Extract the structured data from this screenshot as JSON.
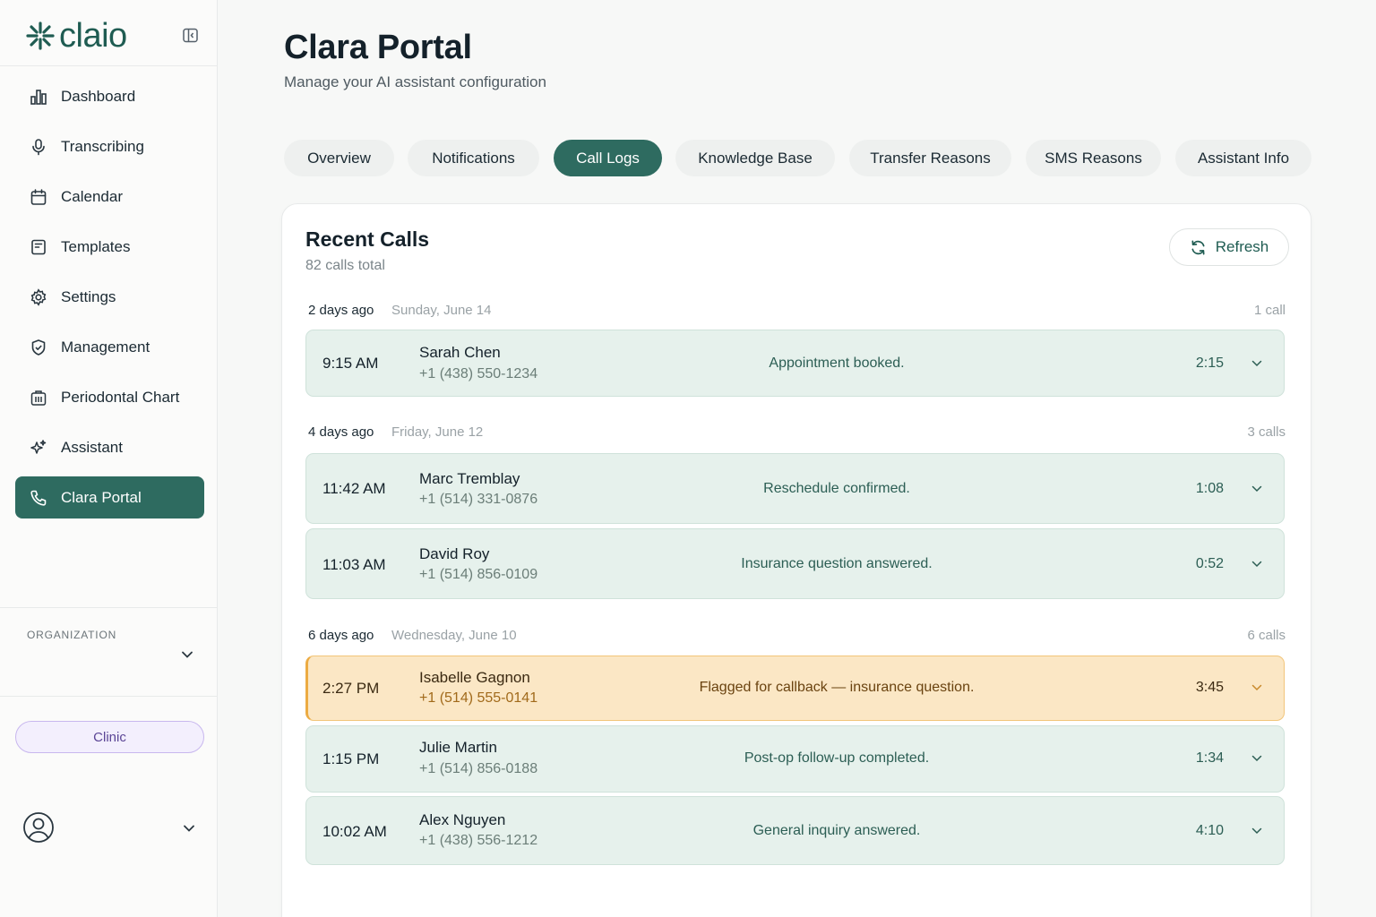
{
  "brand": {
    "name": "claio"
  },
  "sidebar": {
    "items": [
      {
        "label": "Dashboard",
        "icon": "bar-chart-icon",
        "active": false
      },
      {
        "label": "Transcribing",
        "icon": "microphone-icon",
        "active": false
      },
      {
        "label": "Calendar",
        "icon": "calendar-icon",
        "active": false
      },
      {
        "label": "Templates",
        "icon": "template-icon",
        "active": false
      },
      {
        "label": "Settings",
        "icon": "gear-icon",
        "active": false
      },
      {
        "label": "Management",
        "icon": "shield-icon",
        "active": false
      },
      {
        "label": "Periodontal Chart",
        "icon": "tooth-chart-icon",
        "active": false
      },
      {
        "label": "Assistant",
        "icon": "sparkle-icon",
        "active": false
      },
      {
        "label": "Clara Portal",
        "icon": "phone-icon",
        "active": true
      }
    ],
    "organization_label": "ORGANIZATION",
    "clinic_badge": "Clinic"
  },
  "header": {
    "title": "Clara Portal",
    "subtitle": "Manage your AI assistant configuration"
  },
  "tabs": [
    {
      "label": "Overview",
      "active": false
    },
    {
      "label": "Notifications",
      "active": false
    },
    {
      "label": "Call Logs",
      "active": true
    },
    {
      "label": "Knowledge Base",
      "active": false
    },
    {
      "label": "Transfer Reasons",
      "active": false
    },
    {
      "label": "SMS Reasons",
      "active": false
    },
    {
      "label": "Assistant Info",
      "active": false
    }
  ],
  "recent_calls": {
    "title": "Recent Calls",
    "total": "82 calls total",
    "refresh_label": "Refresh",
    "groups": [
      {
        "relative": "2 days ago",
        "date": "Sunday, June 14",
        "count": "1 call",
        "calls": [
          {
            "time": "9:15 AM",
            "name": "Sarah Chen",
            "phone": "+1 (438) 550-1234",
            "summary": "Appointment booked.",
            "duration": "2:15",
            "flagged": false
          }
        ]
      },
      {
        "relative": "4 days ago",
        "date": "Friday, June 12",
        "count": "3 calls",
        "calls": [
          {
            "time": "11:42 AM",
            "name": "Marc Tremblay",
            "phone": "+1 (514) 331-0876",
            "summary": "Reschedule confirmed.",
            "duration": "1:08",
            "flagged": false
          },
          {
            "time": "11:03 AM",
            "name": "David Roy",
            "phone": "+1 (514) 856-0109",
            "summary": "Insurance question answered.",
            "duration": "0:52",
            "flagged": false
          }
        ]
      },
      {
        "relative": "6 days ago",
        "date": "Wednesday, June 10",
        "count": "6 calls",
        "calls": [
          {
            "time": "2:27 PM",
            "name": "Isabelle Gagnon",
            "phone": "+1 (514) 555-0141",
            "summary": "Flagged for callback — insurance question.",
            "duration": "3:45",
            "flagged": true
          },
          {
            "time": "1:15 PM",
            "name": "Julie Martin",
            "phone": "+1 (514) 856-0188",
            "summary": "Post-op follow-up completed.",
            "duration": "1:34",
            "flagged": false
          },
          {
            "time": "10:02 AM",
            "name": "Alex Nguyen",
            "phone": "+1 (438) 556-1212",
            "summary": "General inquiry answered.",
            "duration": "4:10",
            "flagged": false
          }
        ]
      }
    ]
  },
  "colors": {
    "brand": "#1f5c52",
    "active": "#2e6b60",
    "row_bg": "#e6f1ec",
    "flag_bg": "#fbe7c5",
    "flag_accent": "#ecab42"
  }
}
